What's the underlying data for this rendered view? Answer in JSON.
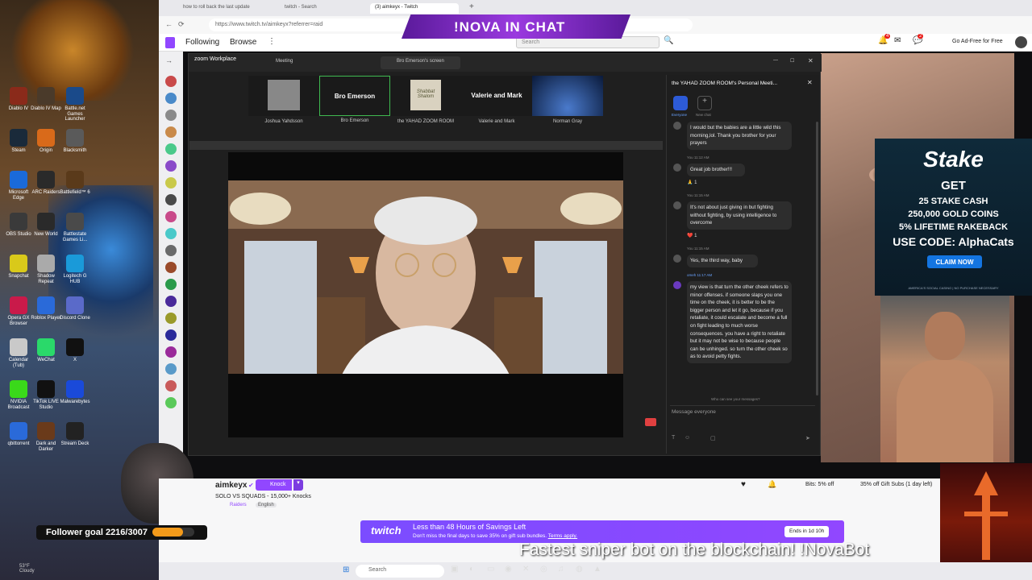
{
  "browser": {
    "tabs": [
      "how to roll back the last update",
      "twitch - Search",
      "(3) aimkeyx - Twitch"
    ],
    "url": "https://www.twitch.tv/aimkeyx?referrer=raid"
  },
  "twitch_nav": {
    "following": "Following",
    "browse": "Browse",
    "search_placeholder": "Search",
    "ad_free": "Go Ad-Free for Free",
    "badge_notifications": "4",
    "badge_whispers": "2"
  },
  "overlay": {
    "nova": "!NOVA  IN CHAT",
    "follower_goal": "Follower goal 2216/3007",
    "sniper": "Fastest sniper bot on the blockchain! !NovaBot"
  },
  "desktop_icons": [
    "Diablo IV",
    "Diablo IV Map",
    "Battle.net Games Launcher",
    "Steam",
    "Origin",
    "Blacksmith",
    "Microsoft Edge",
    "ARC Raiders",
    "Battlefield™ 6",
    "OBS Studio",
    "New World",
    "Battlestate Games Li...",
    "Snapchat",
    "Shadow Repeat",
    "Logitech G HUB",
    "Opera GX Browser",
    "Roblox Player",
    "Discord Clone",
    "Calendar (Tub)",
    "WeChat",
    "X",
    "NVIDIA Broadcast",
    "TikTok LIVE Studio",
    "Malwarebytes",
    "qbittorrent",
    "Dark and Darker",
    "Stream Deck"
  ],
  "zoom": {
    "app": "zoom Workplace",
    "meeting_tab": "Meeting",
    "screen_tab": "Bro Emerson's screen",
    "thumbs": [
      {
        "label": "",
        "name": "Joshua Yahdsson"
      },
      {
        "label": "Bro Emerson",
        "name": "Bro Emerson"
      },
      {
        "label": "Shabbat Shalom",
        "name": "the YAHAD ZOOM ROOM"
      },
      {
        "label": "Valerie and Mark",
        "name": "Valerie and Mark"
      },
      {
        "label": "",
        "name": "Norman Gray"
      }
    ],
    "chat_title": "the YAHAD ZOOM ROOM's Personal Meeti...",
    "chat_tabs": [
      "Everyone",
      "New chat"
    ],
    "messages": [
      {
        "meta": "",
        "text": "I would but the babies are a little wild this morning,lol. Thank you brother for your prayers"
      },
      {
        "meta": "You 11:12 AM",
        "text": "Great job brother!!!",
        "reaction": "🙏 1"
      },
      {
        "meta": "You 11:15 AM",
        "text": "It's not about just giving in but fighting without fighting, by using intelligence to overcome",
        "reaction": "❤️ 1"
      },
      {
        "meta": "You 11:15 AM",
        "text": "Yes, the third way, baby"
      },
      {
        "meta": "omeh 11:17 AM",
        "text": "my view is that turn the other cheek refers to minor offenses. if someone slaps you one time on the cheek, it is better to be the bigger person and let it go, because if you retaliate, it could escalate and become a full on fight leading to much worse consequences. you have a right to retaliate but it may not be wise to because people can be unhinged. so turn the other cheek so as to avoid petty fights."
      }
    ],
    "who_can_see": "Who can see your messages?",
    "message_placeholder": "Message everyone"
  },
  "stake": {
    "brand": "Stake",
    "get": "GET",
    "line1": "25 STAKE CASH",
    "line2": "250,000 GOLD COINS",
    "line3": "5% LIFETIME RAKEBACK",
    "code": "USE CODE: AlphaCats",
    "claim": "CLAIM NOW",
    "fine": "AMERICA'S SOCIAL CASINO | NO PURCHASE NECESSARY"
  },
  "channel": {
    "name": "aimkeyx",
    "knock_button": "Knock",
    "title": "SOLO VS SQUADS - 15,000+ Knocks",
    "category": "Raiders",
    "language": "English",
    "bits": "Bits: 5% off",
    "gift_subs": "35% off Gift Subs (1 day left)"
  },
  "promo": {
    "brand": "twitch",
    "headline": "Less than 48 Hours of Savings Left",
    "sub": "Don't miss the final days to save 35% on gift sub bundles.",
    "apply": "Terms apply.",
    "ends": "Ends in 1d 10h"
  },
  "taskbar": {
    "search": "Search",
    "weather_temp": "53°F",
    "weather_desc": "Cloudy"
  }
}
